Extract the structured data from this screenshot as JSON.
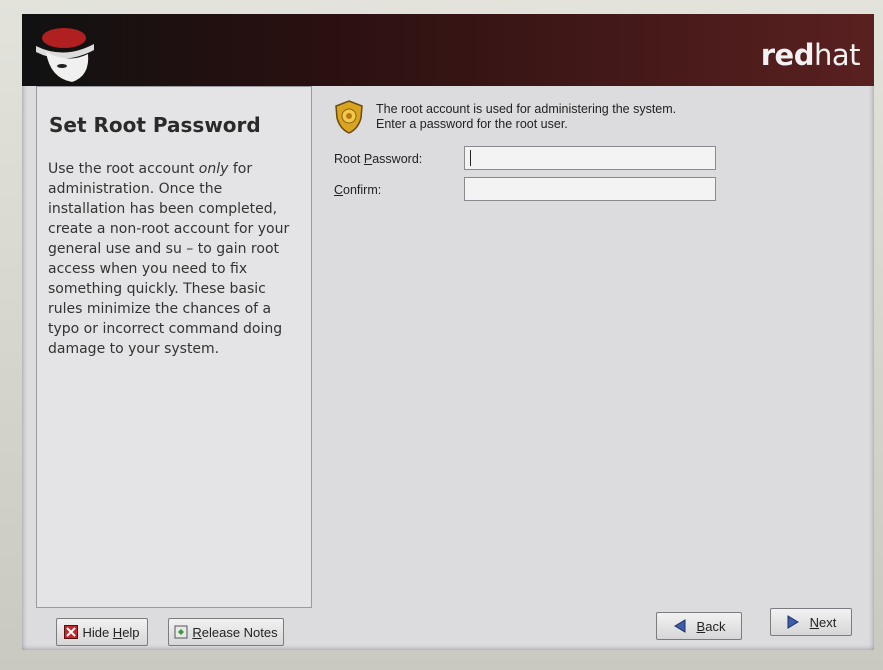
{
  "header": {
    "brand_bold": "red",
    "brand_light": "hat"
  },
  "help": {
    "title": "Set Root Password",
    "text_before": "Use the root account ",
    "text_em": "only",
    "text_after": " for administration. Once the installation has been completed, create a non-root account for your general use and su  – to gain root access when you need to fix something quickly. These basic rules minimize the chances of a typo or incorrect command doing damage to your system."
  },
  "main": {
    "info_line1": "The root account is used for administering the system.",
    "info_line2": "Enter a password for the root user.",
    "root_password_label_pre": "Root ",
    "root_password_label_u": "P",
    "root_password_label_post": "assword:",
    "root_password_value": "",
    "confirm_label_u": "C",
    "confirm_label_post": "onfirm:",
    "confirm_value": ""
  },
  "buttons": {
    "hide_help_pre": "Hide ",
    "hide_help_u": "H",
    "hide_help_post": "elp",
    "release_notes_u": "R",
    "release_notes_post": "elease Notes",
    "back_u": "B",
    "back_post": "ack",
    "next_u": "N",
    "next_post": "ext"
  },
  "colors": {
    "header_dark": "#111111",
    "header_red": "#5a2020",
    "panel_bg": "#e4e4e6"
  }
}
